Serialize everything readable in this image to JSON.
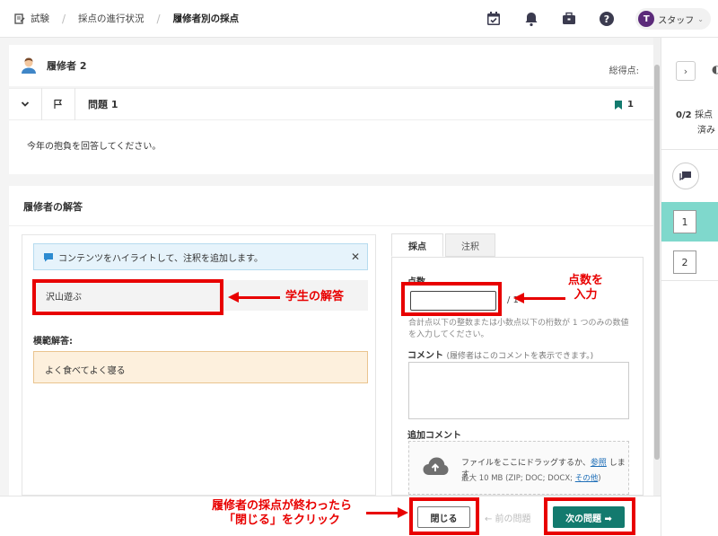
{
  "breadcrumb": {
    "items": [
      "試験",
      "採点の進行状況",
      "履修者別の採点"
    ]
  },
  "header": {
    "user_initial": "T",
    "user_name": "スタッフ"
  },
  "learner": {
    "name": "履修者 2",
    "total_label": "総得点:"
  },
  "question": {
    "title": "問題 1",
    "flag_count": "1",
    "text": "今年の抱負を回答してください。"
  },
  "answer_section": {
    "title": "履修者の解答",
    "banner_text": "コンテンツをハイライトして、注釈を追加します。",
    "student_answer": "沢山遊ぶ",
    "model_label": "模範解答:",
    "model_answer": "よく食べてよく寝る"
  },
  "grading": {
    "tabs": [
      "採点",
      "注釈"
    ],
    "score_label": "点数",
    "score_value": "",
    "score_max": "/ 1",
    "hint": "合計点以下の整数または小数点以下の桁数が 1 つのみの数値を入力してください。",
    "comment_label": "コメント",
    "comment_sub": "(履修者はこのコメントを表示できます。)",
    "add_comment_label": "追加コメント",
    "drop_text_1": "ファイルをここにドラッグするか、",
    "drop_link": "参照",
    "drop_text_2": "します",
    "drop_sub_1": "最大 10 MB (ZIP; DOC; DOCX;",
    "drop_sub_link": "その他",
    "drop_sub_2": ")"
  },
  "footer": {
    "close_label": "閉じる",
    "prev_label": "← 前の問題",
    "next_label": "次の問題 ➡"
  },
  "side": {
    "toggle": "›",
    "count": "0/2",
    "count_label_1": "採点",
    "count_label_2": "済み",
    "questions": [
      "1",
      "2"
    ]
  },
  "annotations": {
    "student_answer_note": "学生の解答",
    "score_note_1": "点数を",
    "score_note_2": "入力",
    "close_note_1": "履修者の採点が終わったら",
    "close_note_2": "「閉じる」をクリック"
  },
  "colors": {
    "accent_teal": "#137a6e",
    "active_item": "#7fd8cc",
    "annotation_red": "#e80000",
    "avatar": "#5b2a7a"
  }
}
